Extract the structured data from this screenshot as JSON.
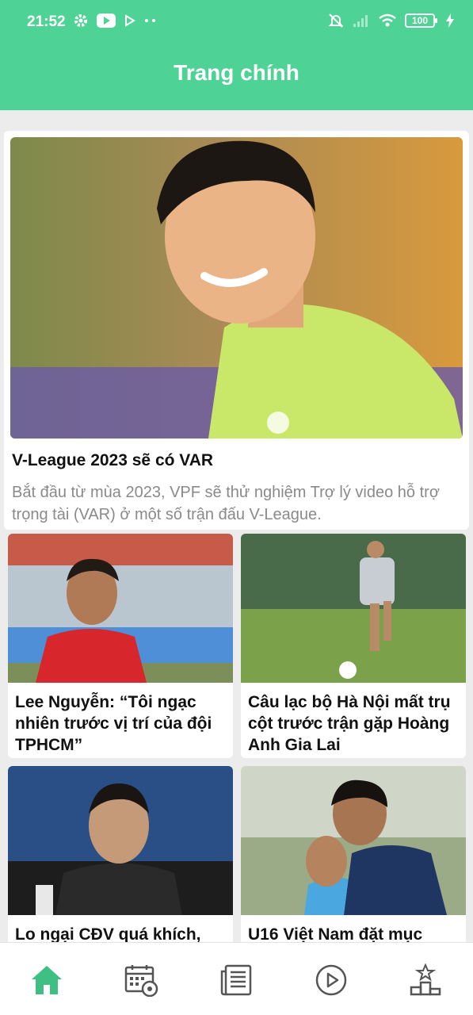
{
  "status_bar": {
    "time": "21:52",
    "battery": "100",
    "icons_left": [
      "gear-icon",
      "youtube-icon",
      "play-store-icon",
      "more-dots-icon"
    ],
    "icons_right": [
      "mute-icon",
      "signal-icon",
      "wifi-icon",
      "battery-icon",
      "charging-icon"
    ]
  },
  "app_bar": {
    "title": "Trang chính"
  },
  "colors": {
    "accent": "#4fd295",
    "nav_active": "#3fbf83",
    "nav_inactive": "#555555",
    "desc": "#8a8a8a"
  },
  "feed": {
    "featured": {
      "title": "V-League 2023 sẽ có VAR",
      "description": "Bắt đầu từ mùa 2023, VPF sẽ thử nghiệm Trợ lý video hỗ trợ trọng tài (VAR) ở một số trận đấu V-League."
    },
    "articles": [
      {
        "title": "Lee Nguyễn: “Tôi ngạc nhiên trước vị trí của đội TPHCM”"
      },
      {
        "title": "Câu lạc bộ Hà Nội mất trụ cột trước trận gặp Hoàng Anh Gia Lai"
      },
      {
        "title": "Lo ngại CĐV quá khích,"
      },
      {
        "title": "U16 Việt Nam đặt mục"
      }
    ]
  },
  "bottom_nav": {
    "items": [
      {
        "icon": "home-icon",
        "active": true
      },
      {
        "icon": "calendar-icon",
        "active": false
      },
      {
        "icon": "news-icon",
        "active": false
      },
      {
        "icon": "video-icon",
        "active": false
      },
      {
        "icon": "ranking-icon",
        "active": false
      }
    ]
  }
}
